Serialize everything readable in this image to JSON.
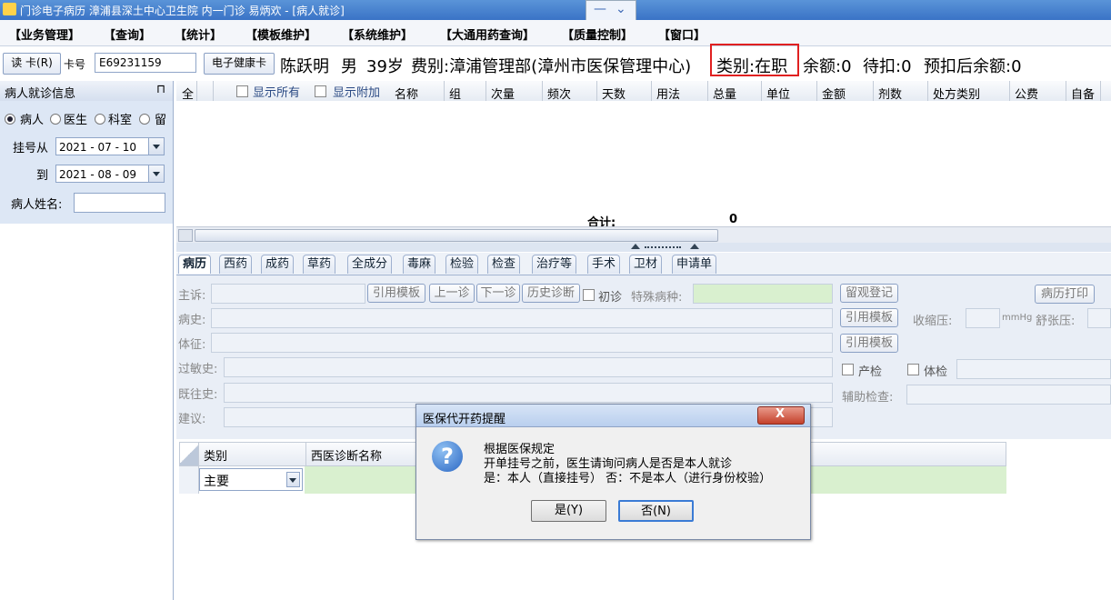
{
  "window": {
    "title": "门诊电子病历  漳浦县深土中心卫生院  内一门诊  易炳欢 - [病人就诊]",
    "minimize_glyph": "—",
    "dropdown_glyph": "⌄"
  },
  "menu": {
    "items": [
      "【业务管理】",
      "【查询】",
      "【统计】",
      "【模板维护】",
      "【系统维护】",
      "【大通用药查询】",
      "【质量控制】",
      "【窗口】"
    ]
  },
  "patient_bar": {
    "read_card": "读 卡(R)",
    "card_label": "卡号",
    "card_value": "E69231159",
    "e_health_card": "电子健康卡",
    "name": "陈跃明",
    "sex": "男",
    "age": "39岁",
    "fee_type": "费别:漳浦管理部(漳州市医保管理中心)",
    "category": "类别:在职",
    "balance": "余额:0",
    "pending": "待扣:0",
    "after_balance": "预扣后余额:0"
  },
  "left_panel": {
    "title": "病人就诊信息",
    "pin": "⊓",
    "radios": [
      "病人",
      "医生",
      "科室",
      "留"
    ],
    "reg_from_label": "挂号从",
    "reg_from": "2021 - 07 - 10",
    "reg_to_label": "到",
    "reg_to": "2021 - 08 - 09",
    "patient_name_label": "病人姓名:"
  },
  "rx_grid": {
    "columns": [
      "全",
      "显示所有",
      "显示附加",
      "名称",
      "组",
      "次量",
      "频次",
      "天数",
      "用法",
      "总量",
      "单位",
      "金额",
      "剂数",
      "处方类别",
      "公费",
      "自备"
    ],
    "total_label": "合计:",
    "total_value": "0"
  },
  "tabs": [
    "病历",
    "西药",
    "成药",
    "草药",
    "全成分",
    "毒麻",
    "检验",
    "检查",
    "治疗等",
    "手术",
    "卫材",
    "申请单"
  ],
  "form": {
    "complaint": "主诉:",
    "history": "病史:",
    "signs": "体征:",
    "allergy": "过敏史:",
    "past_history": "既往史:",
    "advice": "建议:",
    "cite_template": "引用模板",
    "prev_visit": "上一诊",
    "next_visit": "下一诊",
    "history_diag": "历史诊断",
    "first_visit": "初诊",
    "special_disease": "特殊病种:",
    "observe_reg": "留观登记",
    "print_record": "病历打印",
    "systolic": "收缩压:",
    "mmhg": "mmHg",
    "diastolic": "舒张压:",
    "prenatal": "产检",
    "physical": "体检",
    "aux_exam": "辅助检查:"
  },
  "diagnosis": {
    "col_type": "类别",
    "col_name": "西医诊断名称",
    "row_type": "主要"
  },
  "dialog": {
    "title": "医保代开药提醒",
    "line1": "根据医保规定",
    "line2": "开单挂号之前，医生请询问病人是否是本人就诊",
    "line3": "是：本人（直接挂号）  否：不是本人（进行身份校验）",
    "yes": "是(Y)",
    "no": "否(N)",
    "close": "X"
  }
}
